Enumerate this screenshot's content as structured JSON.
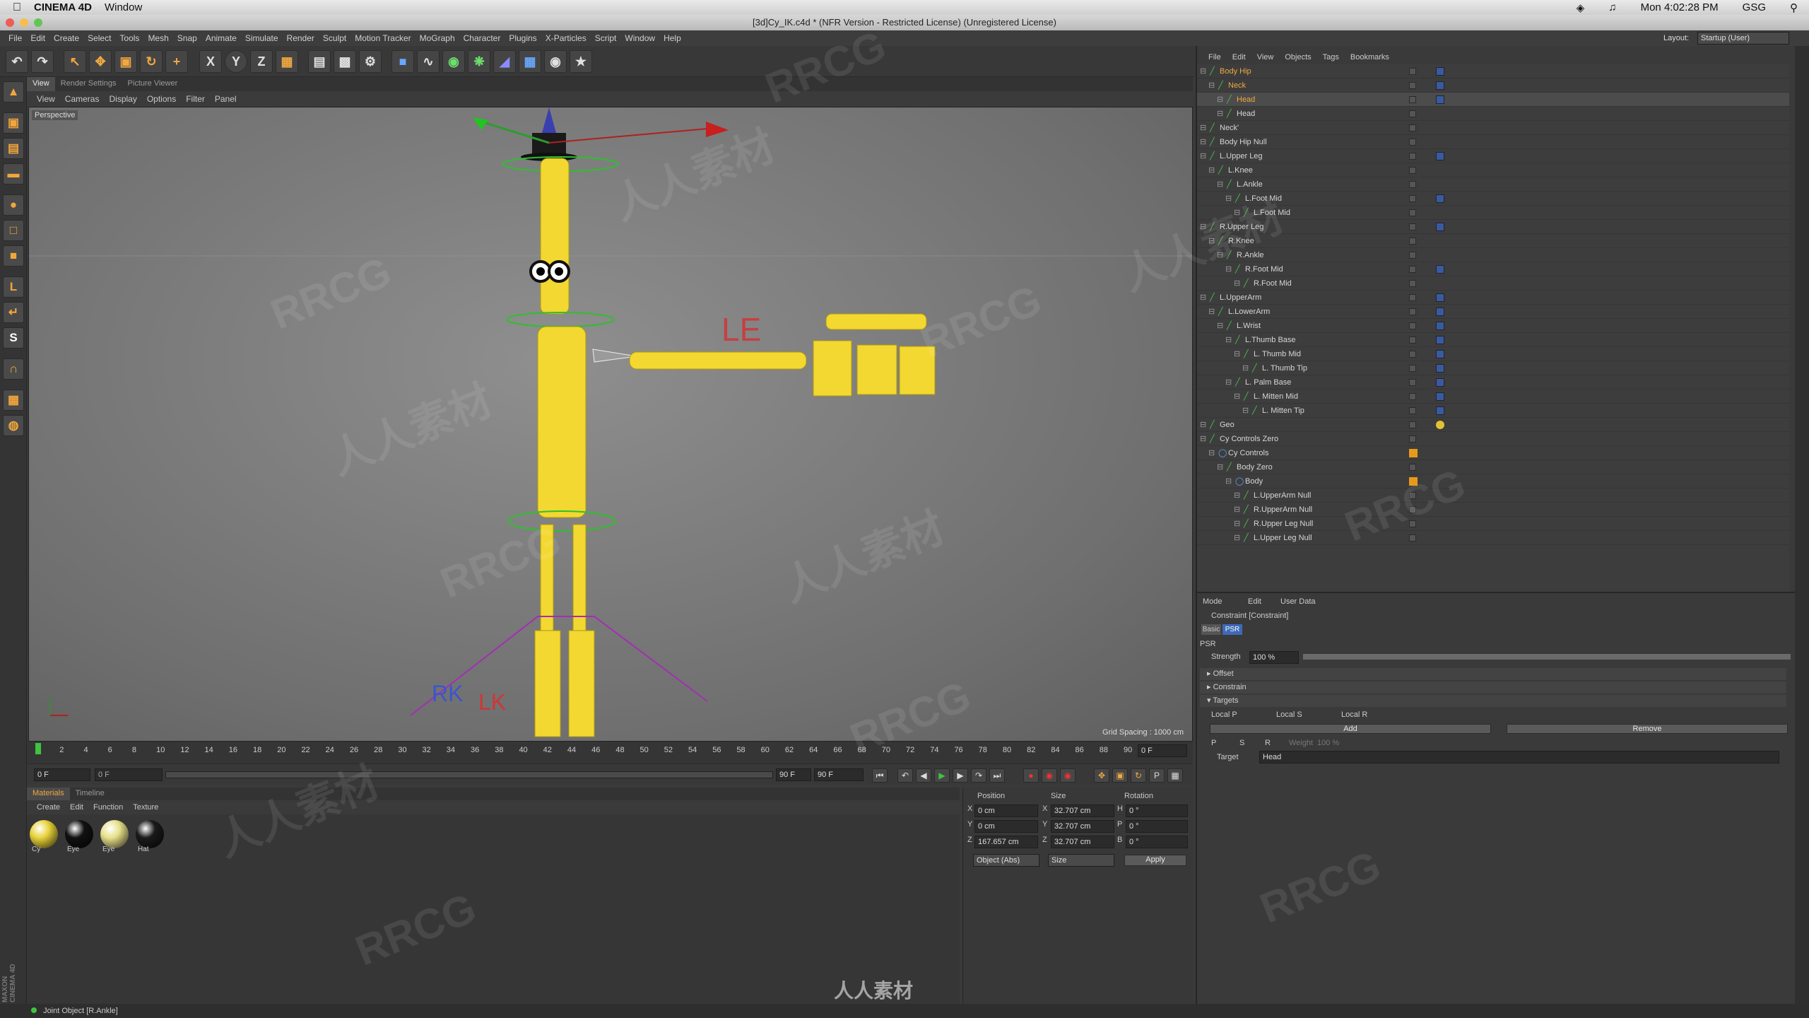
{
  "mac_menubar": {
    "app": "CINEMA 4D",
    "menu": "Window",
    "clock": "Mon 4:02:28 PM",
    "user": "GSG"
  },
  "window_title": "[3d]Cy_IK.c4d * (NFR Version - Restricted License) (Unregistered License)",
  "main_menu": [
    "File",
    "Edit",
    "Create",
    "Select",
    "Tools",
    "Mesh",
    "Snap",
    "Animate",
    "Simulate",
    "Render",
    "Sculpt",
    "Motion Tracker",
    "MoGraph",
    "Character",
    "Plugins",
    "X-Particles",
    "Script",
    "Window",
    "Help"
  ],
  "toolbar_axis": {
    "x": "X",
    "y": "Y",
    "z": "Z"
  },
  "viewport": {
    "tabs": [
      "View",
      "Render Settings",
      "Picture Viewer"
    ],
    "menu": [
      "View",
      "Cameras",
      "Display",
      "Options",
      "Filter",
      "Panel"
    ],
    "label": "Perspective",
    "grid_spacing": "Grid Spacing : 1000 cm"
  },
  "timeline": {
    "ticks": [
      "0",
      "2",
      "4",
      "6",
      "8",
      "10",
      "12",
      "14",
      "16",
      "18",
      "20",
      "22",
      "24",
      "26",
      "28",
      "30",
      "32",
      "34",
      "36",
      "38",
      "40",
      "42",
      "44",
      "46",
      "48",
      "50",
      "52",
      "54",
      "56",
      "58",
      "60",
      "62",
      "64",
      "66",
      "68",
      "70",
      "72",
      "74",
      "76",
      "78",
      "80",
      "82",
      "84",
      "86",
      "88",
      "90"
    ],
    "current_frame_field": "0 F",
    "end_frame_right": "0 F",
    "start_field": "0 F",
    "preview_start": "0 F",
    "preview_end": "90 F",
    "end_field": "90 F"
  },
  "materials": {
    "tabs": [
      "Materials",
      "Timeline"
    ],
    "menu": [
      "Create",
      "Edit",
      "Function",
      "Texture"
    ],
    "items": [
      {
        "name": "Cy",
        "color": "#e8d23a"
      },
      {
        "name": "Eye",
        "color": "#111111"
      },
      {
        "name": "Eye",
        "color": "#e7e08a"
      },
      {
        "name": "Hat",
        "color": "#1a1a1a"
      }
    ]
  },
  "coordinates": {
    "headers": [
      "Position",
      "Size",
      "Rotation"
    ],
    "rows": [
      {
        "axis": "X",
        "pos": "0 cm",
        "size_axis": "X",
        "size": "32.707 cm",
        "rot_axis": "H",
        "rot": "0 °"
      },
      {
        "axis": "Y",
        "pos": "0 cm",
        "size_axis": "Y",
        "size": "32.707 cm",
        "rot_axis": "P",
        "rot": "0 °"
      },
      {
        "axis": "Z",
        "pos": "167.657 cm",
        "size_axis": "Z",
        "size": "32.707 cm",
        "rot_axis": "B",
        "rot": "0 °"
      }
    ],
    "mode": "Object (Abs)",
    "size_mode": "Size",
    "apply": "Apply"
  },
  "object_manager": {
    "menu": [
      "File",
      "Edit",
      "View",
      "Objects",
      "Tags",
      "Bookmarks"
    ],
    "layout_label": "Layout:",
    "layout_value": "Startup (User)",
    "objects": [
      {
        "name": "Body Hip",
        "depth": 0,
        "highlight": true,
        "tag": "blue"
      },
      {
        "name": "Neck",
        "depth": 1,
        "highlight": true,
        "tag": "blue"
      },
      {
        "name": "Head",
        "depth": 2,
        "highlight": true,
        "selected": true,
        "tag": "blue"
      },
      {
        "name": "Head",
        "depth": 2,
        "tag": ""
      },
      {
        "name": "Neck'",
        "depth": 0,
        "tag": ""
      },
      {
        "name": "Body Hip Null",
        "depth": 0,
        "tag": ""
      },
      {
        "name": "L.Upper Leg",
        "depth": 0,
        "tag": "blue"
      },
      {
        "name": "L.Knee",
        "depth": 1,
        "tag": ""
      },
      {
        "name": "L.Ankle",
        "depth": 2,
        "tag": ""
      },
      {
        "name": "L.Foot Mid",
        "depth": 3,
        "tag": "blue"
      },
      {
        "name": "L.Foot Mid",
        "depth": 4,
        "tag": ""
      },
      {
        "name": "R.Upper Leg",
        "depth": 0,
        "tag": "blue"
      },
      {
        "name": "R.Knee",
        "depth": 1,
        "tag": ""
      },
      {
        "name": "R.Ankle",
        "depth": 2,
        "tag": ""
      },
      {
        "name": "R.Foot Mid",
        "depth": 3,
        "tag": "blue"
      },
      {
        "name": "R.Foot Mid",
        "depth": 4,
        "tag": ""
      },
      {
        "name": "L.UpperArm",
        "depth": 0,
        "tag": "blue"
      },
      {
        "name": "L.LowerArm",
        "depth": 1,
        "tag": "blue"
      },
      {
        "name": "L.Wrist",
        "depth": 2,
        "tag": "blue"
      },
      {
        "name": "L.Thumb Base",
        "depth": 3,
        "tag": "blue"
      },
      {
        "name": "L. Thumb Mid",
        "depth": 4,
        "tag": "blue"
      },
      {
        "name": "L. Thumb Tip",
        "depth": 5,
        "tag": "blue"
      },
      {
        "name": "L. Palm Base",
        "depth": 3,
        "tag": "blue"
      },
      {
        "name": "L. Mitten Mid",
        "depth": 4,
        "tag": "blue"
      },
      {
        "name": "L. Mitten Tip",
        "depth": 5,
        "tag": "blue"
      },
      {
        "name": "Geo",
        "depth": 0,
        "tag": "yellow"
      },
      {
        "name": "Cy Controls Zero",
        "depth": 0,
        "tag": ""
      },
      {
        "name": "Cy Controls",
        "depth": 1,
        "tag": "",
        "layer": true
      },
      {
        "name": "Body Zero",
        "depth": 2,
        "tag": ""
      },
      {
        "name": "Body",
        "depth": 3,
        "tag": "",
        "layer": true
      },
      {
        "name": "L.UpperArm Null",
        "depth": 4,
        "tag": ""
      },
      {
        "name": "R.UpperArm Null",
        "depth": 4,
        "tag": ""
      },
      {
        "name": "R.Upper Leg  Null",
        "depth": 4,
        "tag": ""
      },
      {
        "name": "L.Upper Leg  Null",
        "depth": 4,
        "tag": ""
      }
    ]
  },
  "attributes": {
    "menu": [
      "Mode",
      "Edit",
      "User Data"
    ],
    "title": "Constraint [Constraint]",
    "tabs": [
      "Basic",
      "PSR"
    ],
    "section": "PSR",
    "strength_label": "Strength",
    "strength_value": "100 %",
    "strength": 1.0,
    "groups": [
      "Offset",
      "Constrain",
      "Targets"
    ],
    "local": [
      "Local P",
      "Local S",
      "Local R"
    ],
    "add": "Add",
    "remove": "Remove",
    "psr_flags": [
      "P",
      "S",
      "R"
    ],
    "weight_label": "Weight",
    "weight_value": "100 %",
    "target_label": "Target",
    "target_value": "Head"
  },
  "status": "Joint Object [R.Ankle]",
  "viewport_labels": {
    "le": "LE",
    "rk": "RK",
    "lk": "LK"
  },
  "watermark": [
    "RRCG",
    "人人素材"
  ],
  "maxon_logo": "MAXON CINEMA 4D",
  "colors": {
    "accent": "#f0a840",
    "mesh_yellow": "#f2d830",
    "tag_blue": "#3b5a9e"
  }
}
